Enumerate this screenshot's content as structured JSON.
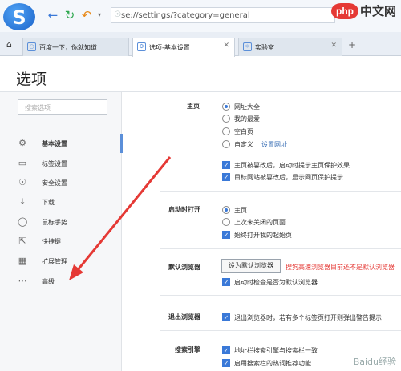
{
  "browser": {
    "logo_letter": "S",
    "url": "se://settings/?category=general",
    "watermark_badge": "php",
    "watermark_text": "中文网"
  },
  "tabs": [
    {
      "label": "百度一下，你就知道"
    },
    {
      "label": "选项-基本设置"
    },
    {
      "label": "实验室"
    }
  ],
  "page": {
    "title": "选项"
  },
  "sidebar": {
    "search_placeholder": "搜索选项",
    "items": [
      {
        "label": "基本设置",
        "icon": "gear-icon"
      },
      {
        "label": "标签设置",
        "icon": "tab-icon"
      },
      {
        "label": "安全设置",
        "icon": "shield-icon"
      },
      {
        "label": "下载",
        "icon": "download-icon"
      },
      {
        "label": "鼠标手势",
        "icon": "mouse-icon"
      },
      {
        "label": "快捷键",
        "icon": "shortcut-icon"
      },
      {
        "label": "扩展管理",
        "icon": "extension-icon"
      },
      {
        "label": "高级",
        "icon": "more-icon"
      }
    ]
  },
  "settings": {
    "homepage": {
      "label": "主页",
      "options": [
        "网址大全",
        "我的最爱",
        "空白页",
        "自定义"
      ],
      "selected": "网址大全",
      "custom_link": "设置网址",
      "checks": [
        "主页被篡改后，启动时提示主页保护效果",
        "目标网站被篡改后，显示网页保护提示"
      ]
    },
    "startup": {
      "label": "启动时打开",
      "options": [
        "主页",
        "上次未关闭的页面"
      ],
      "selected": "主页",
      "check": "始终打开我的起始页"
    },
    "default_browser": {
      "label": "默认浏览器",
      "button": "设为默认浏览器",
      "warning": "搜狗高速浏览器目前还不是默认浏览器",
      "check": "启动时检查是否为默认浏览器"
    },
    "exit": {
      "label": "退出浏览器",
      "check": "退出浏览器时，若有多个标签页打开则弹出警告提示"
    },
    "search": {
      "label": "搜索引擎",
      "checks": [
        "地址栏搜索引擎与搜索栏一致",
        "启用搜索栏的热词推荐功能"
      ]
    }
  },
  "watermark_corner": "Baidu经验"
}
